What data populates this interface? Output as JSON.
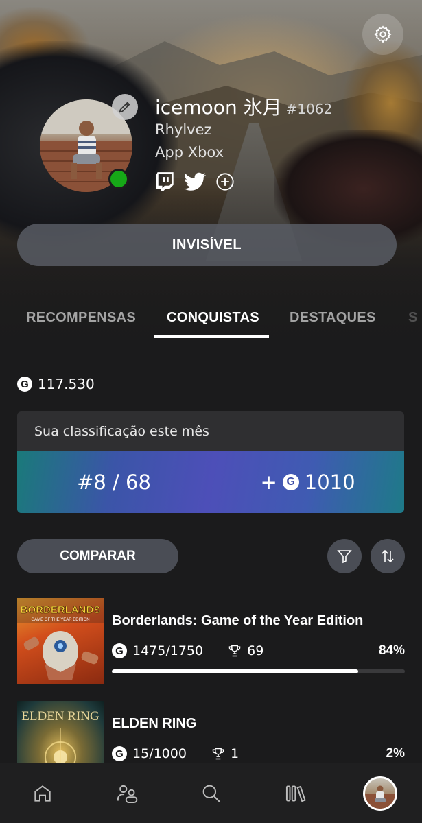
{
  "profile": {
    "gamertag": "icemoon 氷月",
    "gamertag_suffix": "#1062",
    "real_name": "Rhylvez",
    "platform": "App Xbox",
    "online": true,
    "presence_button": "INVISÍVEL"
  },
  "tabs": [
    {
      "label": "RECOMPENSAS",
      "active": false
    },
    {
      "label": "CONQUISTAS",
      "active": true
    },
    {
      "label": "DESTAQUES",
      "active": false
    },
    {
      "label": "S",
      "active": false
    }
  ],
  "gamerscore": {
    "badge": "G",
    "total": "117.530"
  },
  "ranking": {
    "heading": "Sua classificação este mês",
    "rank": "#8 / 68",
    "gain_prefix": "+",
    "gain_value": "1010"
  },
  "actions": {
    "compare_label": "COMPARAR"
  },
  "games": [
    {
      "title": "Borderlands: Game of the Year Edition",
      "cover_text": "BORDERLANDS",
      "cover_subtext": "GAME OF THE YEAR EDITION",
      "gamerscore": "1475/1750",
      "trophies": "69",
      "percent_label": "84%",
      "progress": 0.84
    },
    {
      "title": "ELDEN RING",
      "cover_text": "ELDEN RING",
      "cover_subtext": "",
      "gamerscore": "15/1000",
      "trophies": "1",
      "percent_label": "2%",
      "progress": 0.02
    }
  ],
  "nav": [
    "home-icon",
    "social-icon",
    "search-icon",
    "library-icon",
    "profile-avatar"
  ],
  "colors": {
    "background": "#1b1b1c",
    "online": "#16a817",
    "button": "#4a4d55",
    "ranking_gradient_start": "#1a7a7a",
    "ranking_gradient_mid": "#4d4fb8"
  }
}
